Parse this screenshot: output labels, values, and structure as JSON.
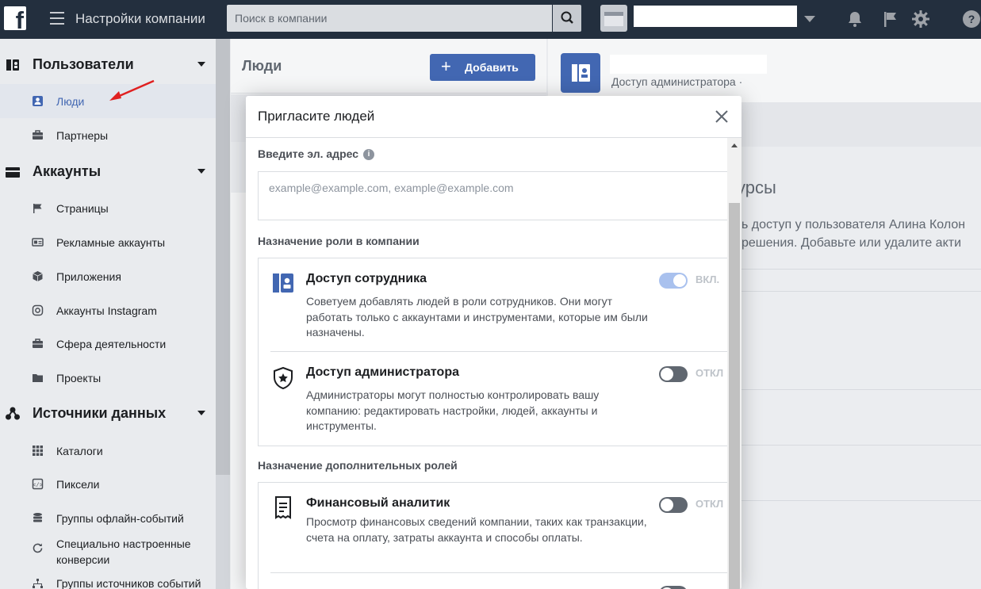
{
  "topbar": {
    "title": "Настройки компании",
    "search_placeholder": "Поиск в компании"
  },
  "sidebar": {
    "sections": [
      {
        "label": "Пользователи",
        "icon": "users-icon"
      },
      {
        "label": "Аккаунты",
        "icon": "accounts-icon"
      },
      {
        "label": "Источники данных",
        "icon": "data-sources-icon"
      }
    ],
    "users_items": [
      {
        "label": "Люди",
        "icon": "person-icon",
        "active": true
      },
      {
        "label": "Партнеры",
        "icon": "briefcase-icon"
      }
    ],
    "accounts_items": [
      {
        "label": "Страницы",
        "icon": "flag-icon"
      },
      {
        "label": "Рекламные аккаунты",
        "icon": "ad-account-icon"
      },
      {
        "label": "Приложения",
        "icon": "cube-icon"
      },
      {
        "label": "Аккаунты Instagram",
        "icon": "instagram-icon"
      },
      {
        "label": "Сфера деятельности",
        "icon": "briefcase-icon"
      },
      {
        "label": "Проекты",
        "icon": "folder-icon"
      }
    ],
    "data_items": [
      {
        "label": "Каталоги",
        "icon": "grid-icon"
      },
      {
        "label": "Пиксели",
        "icon": "pixel-icon"
      },
      {
        "label": "Группы офлайн-событий",
        "icon": "database-icon"
      },
      {
        "label": "Специально настроенные конверсии",
        "icon": "refresh-icon"
      },
      {
        "label": "Группы источников событий",
        "icon": "tree-icon"
      }
    ]
  },
  "middle": {
    "heading": "Люди",
    "add_button": "Добавить"
  },
  "right": {
    "role": "Доступ администратора ·",
    "title_partial": "урсы",
    "text_line1": "ь доступ у пользователя Алина Колон",
    "text_line2": "решения. Добавьте или удалите акти"
  },
  "modal": {
    "title": "Пригласите людей",
    "email_label": "Введите эл. адрес",
    "email_placeholder": "example@example.com, example@example.com",
    "role_section_label": "Назначение роли в компании",
    "extra_section_label": "Назначение дополнительных ролей",
    "roles": [
      {
        "title": "Доступ сотрудника",
        "description": "Советуем добавлять людей в роли сотрудников. Они могут работать только с аккаунтами и инструментами, которые им были назначены.",
        "toggle": "ВКЛ.",
        "enabled": true,
        "icon": "employee-badge-icon"
      },
      {
        "title": "Доступ администратора",
        "description": "Администраторы могут полностью контролировать вашу компанию: редактировать настройки, людей, аккаунты и инструменты.",
        "toggle": "ОТКЛ",
        "enabled": false,
        "icon": "admin-shield-icon"
      }
    ],
    "extra_roles": [
      {
        "title": "Финансовый аналитик",
        "description": "Просмотр финансовых сведений компании, таких как транзакции, счета на оплату, затраты аккаунта и способы оплаты.",
        "toggle": "ОТКЛ",
        "enabled": false,
        "icon": "receipt-icon"
      }
    ]
  },
  "colors": {
    "topbar": "#232f3e",
    "brand": "#4267b2",
    "toggle_on": "#a9c1ee",
    "toggle_off": "#606770",
    "annotation_arrow": "#e02020"
  }
}
